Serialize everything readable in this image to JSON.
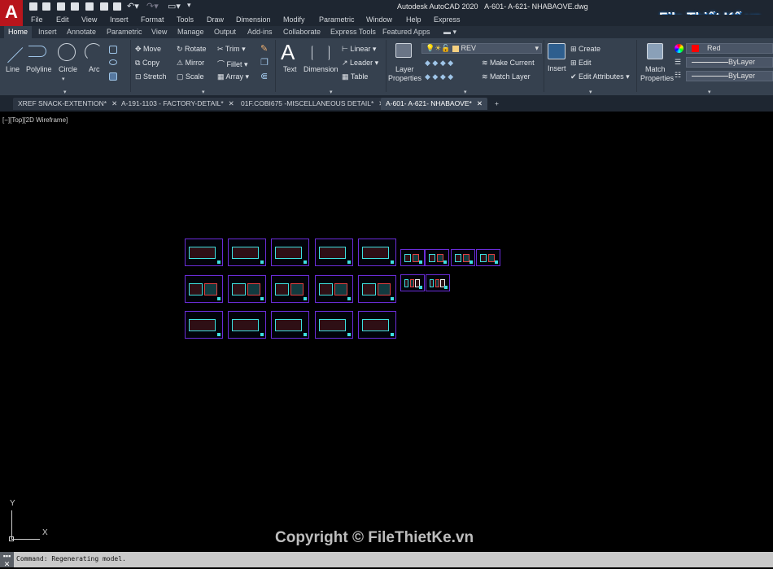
{
  "app": {
    "title": "Autodesk AutoCAD 2020",
    "file": "A-601- A-621- NHABAOVE.dwg",
    "logo_letter": "A",
    "watermark_logo": "File Thiết Kế.vn"
  },
  "menu": [
    "File",
    "Edit",
    "View",
    "Insert",
    "Format",
    "Tools",
    "Draw",
    "Dimension",
    "Modify",
    "Parametric",
    "Window",
    "Help",
    "Express"
  ],
  "ribbon_tabs": [
    "Home",
    "Insert",
    "Annotate",
    "Parametric",
    "View",
    "Manage",
    "Output",
    "Add-ins",
    "Collaborate",
    "Express Tools",
    "Featured Apps"
  ],
  "draw": {
    "line": "Line",
    "polyline": "Polyline",
    "circle": "Circle",
    "arc": "Arc"
  },
  "modify": {
    "move": "Move",
    "copy": "Copy",
    "stretch": "Stretch",
    "rotate": "Rotate",
    "mirror": "Mirror",
    "scale": "Scale",
    "trim": "Trim",
    "fillet": "Fillet",
    "array": "Array"
  },
  "annotation": {
    "text": "Text",
    "dimension": "Dimension",
    "linear": "Linear",
    "leader": "Leader",
    "table": "Table"
  },
  "layers": {
    "properties_1": "Layer",
    "properties_2": "Properties",
    "current_layer": "REV",
    "make_current": "Make Current",
    "match_layer": "Match Layer"
  },
  "block": {
    "insert": "Insert",
    "create": "Create",
    "edit": "Edit",
    "edit_attributes": "Edit Attributes"
  },
  "properties": {
    "match_1": "Match",
    "match_2": "Properties",
    "color": "Red",
    "color_hex": "#ff0000",
    "linetype": "ByLayer",
    "lineweight": "ByLayer"
  },
  "doc_tabs": [
    {
      "label": "XREF SNACK-EXTENTION*",
      "active": false
    },
    {
      "label": "A-191-1103 - FACTORY-DETAIL*",
      "active": false
    },
    {
      "label": "01F.COBI675 -MISCELLANEOUS DETAIL*",
      "active": false
    },
    {
      "label": "A-601- A-621- NHABAOVE*",
      "active": true
    }
  ],
  "viewport": {
    "label": "[−][Top][2D Wireframe]",
    "ucs_x": "X",
    "ucs_y": "Y",
    "watermark": "Copyright © FileThietKe.vn",
    "sheet_border_color": "#6a2cd8"
  },
  "command": {
    "text": "Command: Regenerating model."
  }
}
